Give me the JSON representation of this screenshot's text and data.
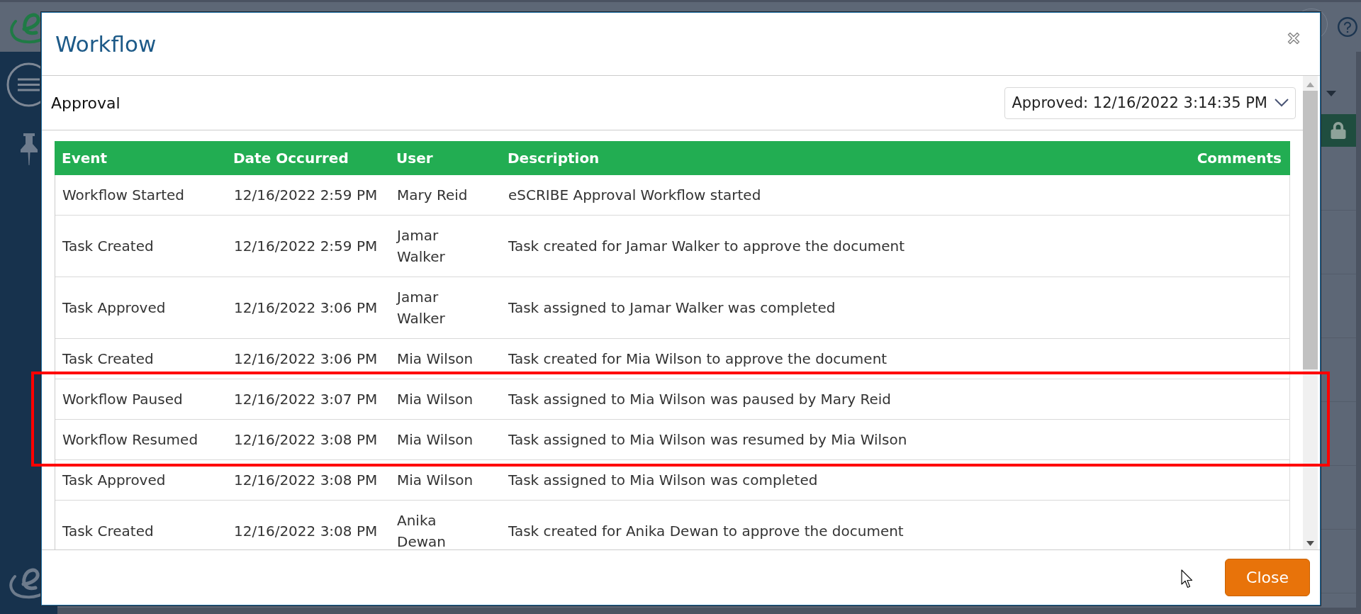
{
  "dialog": {
    "title": "Workflow",
    "section": {
      "label": "Approval",
      "version_select": {
        "value": "Approved: 12/16/2022 3:14:35 PM"
      }
    },
    "table": {
      "columns": [
        "Event",
        "Date Occurred",
        "User",
        "Description",
        "Comments"
      ],
      "rows": [
        {
          "event": "Workflow Started",
          "date_occurred": "12/16/2022 2:59 PM",
          "user": "Mary Reid",
          "description": "eSCRIBE Approval Workflow started",
          "highlighted": false
        },
        {
          "event": "Task Created",
          "date_occurred": "12/16/2022 2:59 PM",
          "user": "Jamar Walker",
          "description": "Task created for Jamar Walker to approve the document",
          "highlighted": false
        },
        {
          "event": "Task Approved",
          "date_occurred": "12/16/2022 3:06 PM",
          "user": "Jamar Walker",
          "description": "Task assigned to Jamar Walker was completed",
          "highlighted": false
        },
        {
          "event": "Task Created",
          "date_occurred": "12/16/2022 3:06 PM",
          "user": "Mia Wilson",
          "description": "Task created for Mia Wilson to approve the document",
          "highlighted": false
        },
        {
          "event": "Workflow Paused",
          "date_occurred": "12/16/2022 3:07 PM",
          "user": "Mia Wilson",
          "description": "Task assigned to Mia Wilson was paused by Mary Reid",
          "highlighted": true
        },
        {
          "event": "Workflow Resumed",
          "date_occurred": "12/16/2022 3:08 PM",
          "user": "Mia Wilson",
          "description": "Task assigned to Mia Wilson was resumed by Mia Wilson",
          "highlighted": true
        },
        {
          "event": "Task Approved",
          "date_occurred": "12/16/2022 3:08 PM",
          "user": "Mia Wilson",
          "description": "Task assigned to Mia Wilson was completed",
          "highlighted": false
        },
        {
          "event": "Task Created",
          "date_occurred": "12/16/2022 3:08 PM",
          "user": "Anika Dewan",
          "description": "Task created for Anika Dewan to approve the document",
          "highlighted": false
        }
      ]
    },
    "buttons": [
      "Close"
    ]
  }
}
